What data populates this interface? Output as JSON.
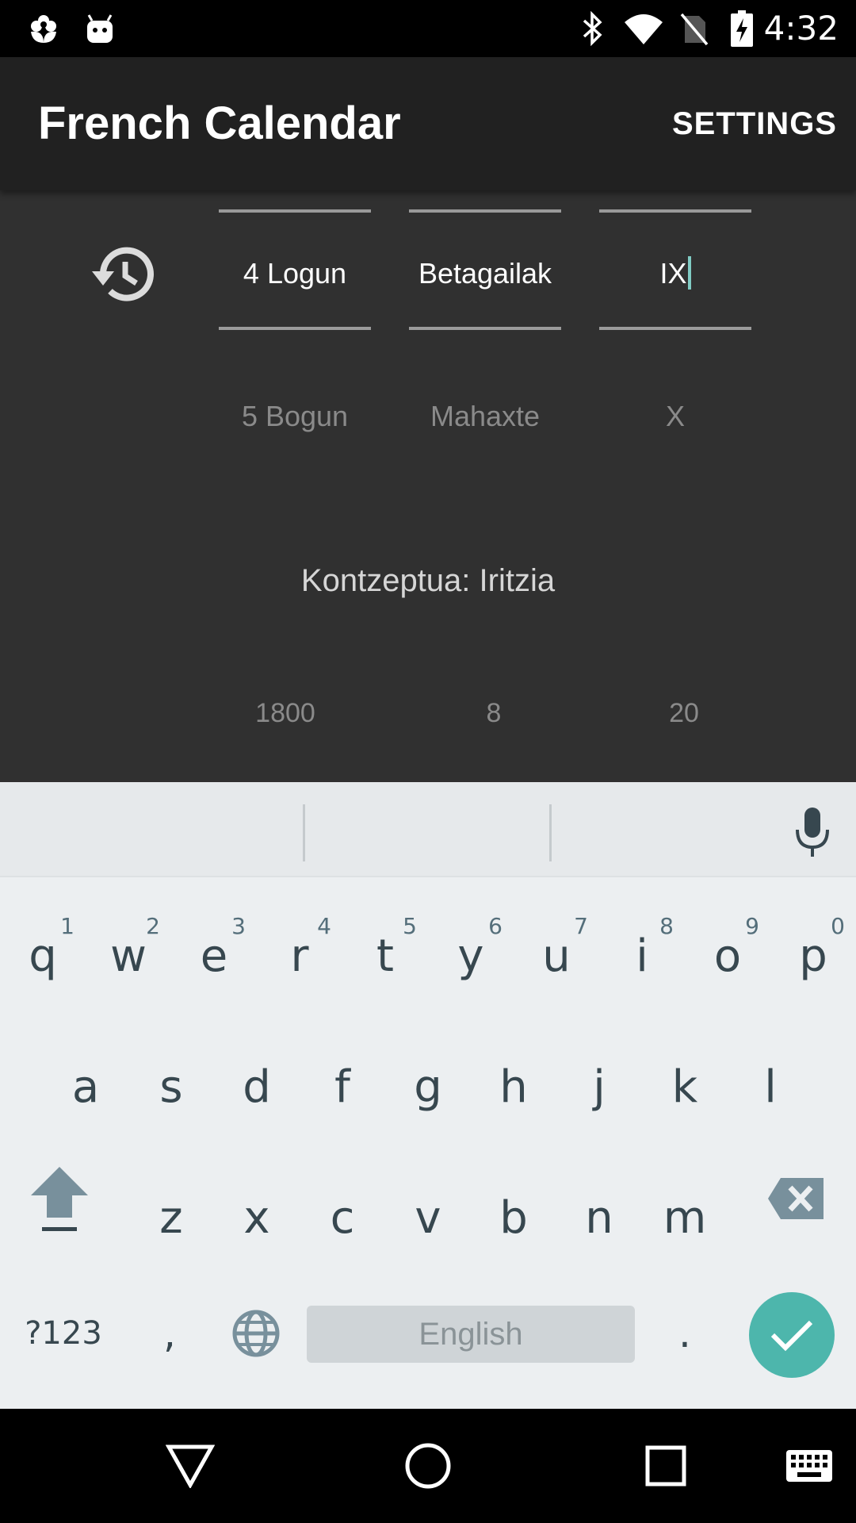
{
  "status_bar": {
    "time": "4:32",
    "left_icons": [
      "flower-icon",
      "android-icon"
    ],
    "right_icons": [
      "bluetooth-icon",
      "wifi-icon",
      "no-sim-icon",
      "battery-charging-icon"
    ]
  },
  "app_bar": {
    "title": "French Calendar",
    "settings_label": "SETTINGS"
  },
  "picker": {
    "day": {
      "selected": "4 Logun",
      "next": "5 Bogun"
    },
    "month": {
      "selected": "Betagailak",
      "next": "Mahaxte"
    },
    "year": {
      "selected": "IX",
      "next": "X"
    }
  },
  "concept_text": "Kontzeptua: Iritzia",
  "gregorian": {
    "year": "1800",
    "month": "8",
    "day": "20"
  },
  "keyboard": {
    "row1": [
      {
        "key": "q",
        "hint": "1"
      },
      {
        "key": "w",
        "hint": "2"
      },
      {
        "key": "e",
        "hint": "3"
      },
      {
        "key": "r",
        "hint": "4"
      },
      {
        "key": "t",
        "hint": "5"
      },
      {
        "key": "y",
        "hint": "6"
      },
      {
        "key": "u",
        "hint": "7"
      },
      {
        "key": "i",
        "hint": "8"
      },
      {
        "key": "o",
        "hint": "9"
      },
      {
        "key": "p",
        "hint": "0"
      }
    ],
    "row2": [
      "a",
      "s",
      "d",
      "f",
      "g",
      "h",
      "j",
      "k",
      "l"
    ],
    "row3": [
      "z",
      "x",
      "c",
      "v",
      "b",
      "n",
      "m"
    ],
    "symbols_label": "?123",
    "comma": ",",
    "period": ".",
    "space_label": "English",
    "accent_color": "#4db6ac"
  },
  "nav_bar": {
    "icons": [
      "back-icon",
      "home-icon",
      "recents-icon",
      "keyboard-icon"
    ]
  }
}
